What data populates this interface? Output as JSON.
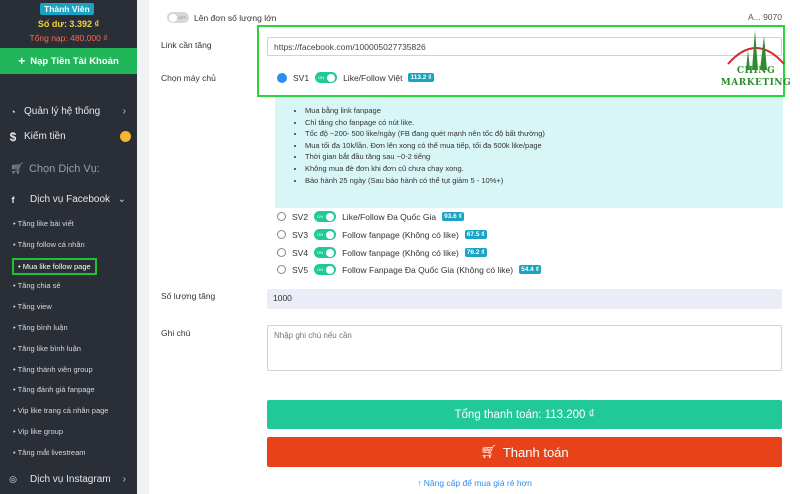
{
  "sidebar": {
    "member_badge": "Thành Viên",
    "balance": "Số dư: 3.392 ₫",
    "deposit_total": "Tổng nạp: 480.000 ₫",
    "topup_label": "Nạp Tiền Tài Khoản",
    "menu_system": "Quản lý hệ thống",
    "menu_earn": "Kiếm tiền",
    "section_label": "Chọn Dịch Vụ:",
    "facebook_group": "Dịch vụ Facebook",
    "facebook_items": [
      "Tăng like bài viết",
      "Tăng follow cá nhân",
      "Mua like follow page",
      "Tăng chia sẻ",
      "Tăng view",
      "Tăng bình luận",
      "Tăng like bình luận",
      "Tăng thành viên group",
      "Tăng đánh giá fanpage",
      "Vip like trang cá nhân page",
      "Vip like group",
      "Tăng mắt livestream"
    ],
    "instagram_group": "Dịch vụ Instagram"
  },
  "main": {
    "bulk_label": "Lên đơn số lượng lớn",
    "top_right_stat": "A... 9070",
    "link_label": "Link cần tăng",
    "link_value": "https://facebook.com/100005027735826",
    "server_label": "Chọn máy chủ",
    "servers": [
      {
        "code": "SV1",
        "name": "Like/Follow Việt",
        "price": "113.2 ₫",
        "selected": true
      },
      {
        "code": "SV2",
        "name": "Like/Follow Đa Quốc Gia",
        "price": "93.6 ₫",
        "selected": false
      },
      {
        "code": "SV3",
        "name": "Follow fanpage (Không có like)",
        "price": "67.5 ₫",
        "selected": false
      },
      {
        "code": "SV4",
        "name": "Follow fanpage (Không có like)",
        "price": "76.2 ₫",
        "selected": false
      },
      {
        "code": "SV5",
        "name": "Follow Fanpage Đa Quốc Gia (Không có like)",
        "price": "54.4 ₫",
        "selected": false
      }
    ],
    "info_items": [
      "Mua bằng link fanpage",
      "Chỉ tăng cho fanpage có nút like.",
      "Tốc độ ~200- 500 like/ngày (FB đang quét mạnh nên tốc độ bất thường)",
      "Mua tối đa 10k/lần. Đơn lên xong có thể mua tiếp, tối đa 500k like/page",
      "Thời gian bắt đầu tăng sau ~0-2 tiếng",
      "Không mua đè đơn khi đơn cũ chưa chạy xong.",
      "Bảo hành 25 ngày (Sau bảo hành có thể tụt giảm 5 - 10%+)"
    ],
    "quantity_label": "Số lượng tăng",
    "quantity_value": "1000",
    "note_label": "Ghi chú",
    "note_placeholder": "Nhập ghi chú nếu cần",
    "total_label": "Tổng thanh toán: 113.200  ₫",
    "pay_label": "Thanh toán",
    "upgrade_label": "↑ Nâng cấp để mua giá rẻ hơn",
    "toggle_on_text": "ON",
    "toggle_off_text": "OFF"
  },
  "logo": {
    "line1": "CHING",
    "line2": "MARKETING"
  },
  "colors": {
    "sidebar_bg": "#2a2e36",
    "accent_teal": "#20c997",
    "pay_red": "#e8421a",
    "highlight_green": "#2bd43a",
    "badge_blue": "#1aa3c4"
  }
}
